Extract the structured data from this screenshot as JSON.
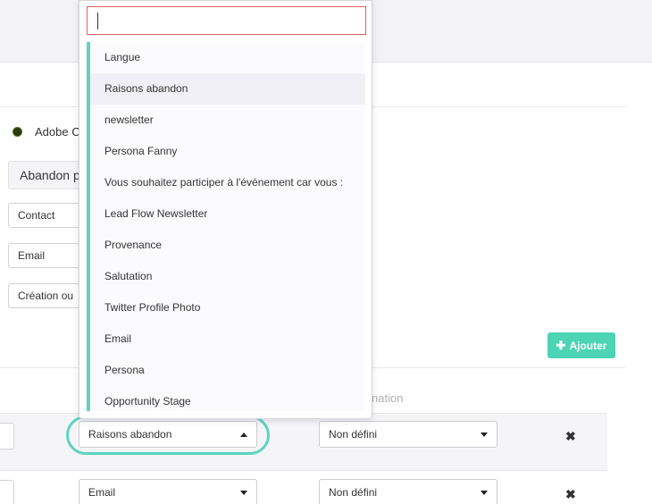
{
  "connector": {
    "name": "Adobe C"
  },
  "form": {
    "action_field": "Abandon p",
    "fields": [
      "Contact",
      "Email",
      "Création ou"
    ]
  },
  "toolbar": {
    "add_label": "Ajouter"
  },
  "table": {
    "col_destination_partial": "nation",
    "rows": [
      {
        "source_select": "Raisons abandon",
        "status_select": "Non défini"
      },
      {
        "source_select": "Email",
        "status_select": "Non défini"
      }
    ]
  },
  "dropdown": {
    "search_value": "",
    "items": [
      "Langue",
      "Raisons abandon",
      "newsletter",
      "Persona Fanny",
      "Vous souhaitez participer à l'événement car vous :",
      "Lead Flow Newsletter",
      "Provenance",
      "Salutation",
      "Twitter Profile Photo",
      "Email",
      "Persona",
      "Opportunity Stage"
    ],
    "hovered_item": "Raisons abandon"
  },
  "colors": {
    "accent": "#4dd4b5",
    "ring": "#5fd3be",
    "search_border": "#e06060"
  },
  "icons": {
    "add": "plus-icon",
    "delete": "close-icon",
    "caret_open": "caret-up-icon",
    "caret_closed": "caret-down-icon"
  }
}
